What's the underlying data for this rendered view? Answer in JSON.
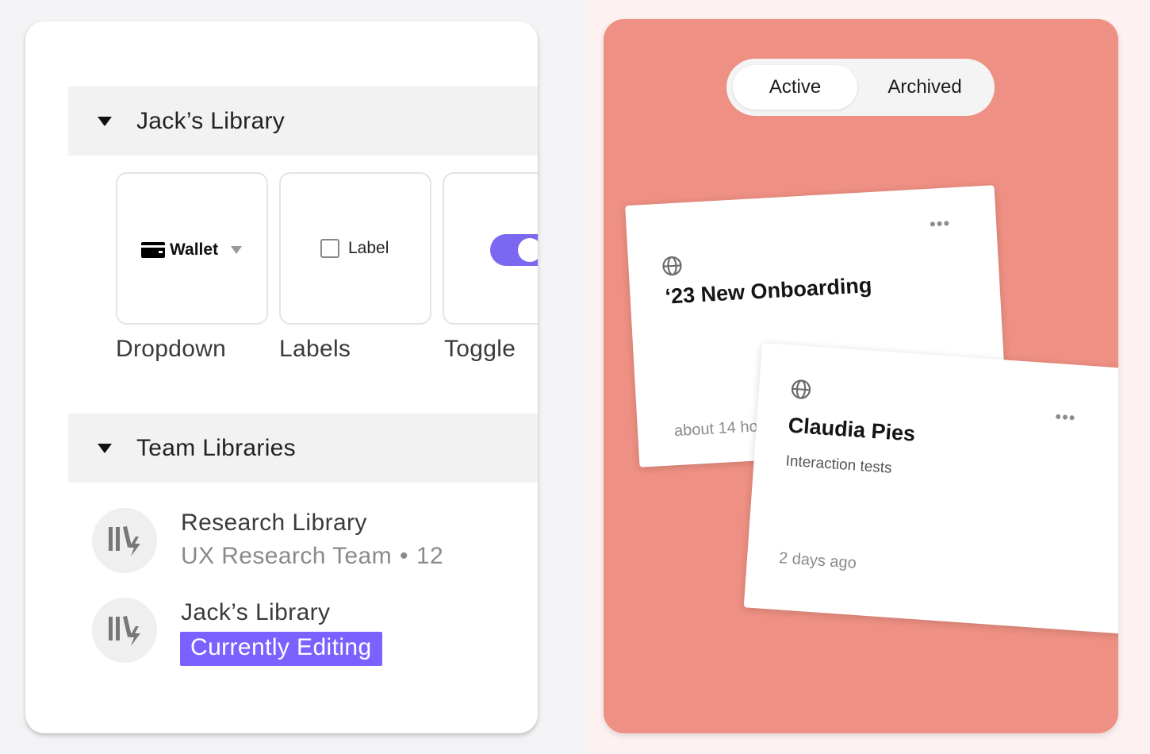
{
  "left_panel": {
    "my_library": {
      "title": "Jack’s Library",
      "components": [
        {
          "caption": "Dropdown",
          "preview_text": "Wallet",
          "icon": "wallet-icon"
        },
        {
          "caption": "Labels",
          "preview_text": "Label",
          "icon": "checkbox-icon"
        },
        {
          "caption": "Toggle",
          "preview_state": "on"
        }
      ]
    },
    "team_libraries": {
      "title": "Team Libraries",
      "items": [
        {
          "name": "Research Library",
          "team": "UX Research Team",
          "separator": "•",
          "count": "12",
          "icon": "library-icon"
        },
        {
          "name": "Jack’s Library",
          "badge": "Currently Editing",
          "icon": "library-icon"
        }
      ]
    }
  },
  "right_panel": {
    "tabs": [
      {
        "label": "Active",
        "selected": true
      },
      {
        "label": "Archived",
        "selected": false
      }
    ],
    "cards": [
      {
        "title": "‘23 New Onboarding",
        "time": "about 14 ho",
        "icon": "globe-icon",
        "menu": "•••"
      },
      {
        "title": "Claudia Pies",
        "subtitle": "Interaction tests",
        "time": "2 days ago",
        "icon": "globe-icon",
        "menu": "•••"
      }
    ]
  },
  "colors": {
    "accent": "#7b61ff",
    "toggle": "#7b68f0",
    "panel_coral": "#ee9083",
    "section_header": "#f2f2f3"
  }
}
